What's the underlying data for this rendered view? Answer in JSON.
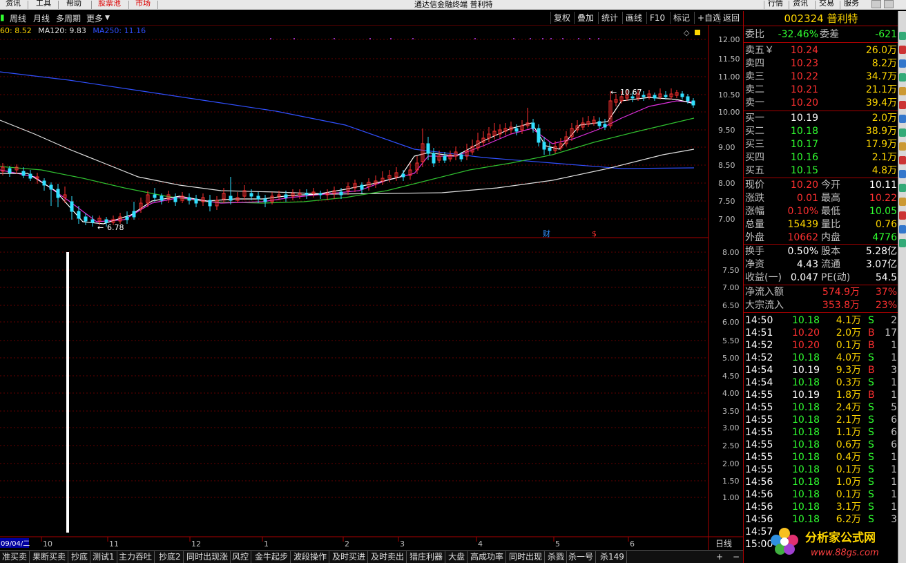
{
  "menubar": {
    "left_items": [
      "资讯",
      "工具",
      "帮助",
      "股票池",
      "市场"
    ],
    "window_title": "通达信金融终端 普利特",
    "right_items": [
      "行情",
      "资讯",
      "交易",
      "服务"
    ]
  },
  "period_bar": {
    "items": [
      "周线",
      "月线",
      "多周期",
      "更多"
    ],
    "right_buttons": [
      "复权",
      "叠加",
      "统计",
      "画线",
      "F10",
      "标记",
      "+自选",
      "返回"
    ]
  },
  "ma_legend": [
    {
      "text": "60: 8.52",
      "color": "#ffd700"
    },
    {
      "text": "MA120: 9.83",
      "color": "#e0e0e0"
    },
    {
      "text": "MA250: 11.16",
      "color": "#3050ff"
    }
  ],
  "price_axis": [
    "12.00",
    "11.50",
    "11.00",
    "10.50",
    "10.00",
    "9.50",
    "9.00",
    "8.50",
    "8.00",
    "7.50",
    "7.00"
  ],
  "lower_axis": [
    "8.00",
    "7.50",
    "7.00",
    "6.50",
    "6.00",
    "5.50",
    "5.00",
    "4.50",
    "4.00",
    "3.50",
    "3.00",
    "2.50",
    "2.00",
    "1.50",
    "1.00"
  ],
  "chart_annotations": {
    "high": "10.67",
    "low": "6.78",
    "fin_marker": "财",
    "s_marker": "$"
  },
  "x_axis": {
    "date_box": "09/04/二",
    "months": [
      "10",
      "11",
      "12",
      "1",
      "2",
      "3",
      "4",
      "5",
      "6"
    ],
    "period_label": "日线"
  },
  "bottom_tabs": [
    "准买卖",
    "果断买卖",
    "抄底",
    "测试1",
    "主力吞吐",
    "抄底2",
    "同时出现涨",
    "风控",
    "金牛起步",
    "波段操作",
    "及时买进",
    "及时卖出",
    "猎庄利器",
    "大盘",
    "高成功率",
    "同时出现",
    "杀戮",
    "杀一号",
    "杀149"
  ],
  "quote": {
    "code": "002324",
    "name": "普利特",
    "weibi": {
      "label": "委比",
      "value": "-32.46%",
      "label2": "委差",
      "value2": "-621"
    },
    "sell": [
      {
        "label": "卖五￥",
        "price": "10.24",
        "vol": "26.0万"
      },
      {
        "label": "卖四",
        "price": "10.23",
        "vol": "8.2万"
      },
      {
        "label": "卖三",
        "price": "10.22",
        "vol": "34.7万"
      },
      {
        "label": "卖二",
        "price": "10.21",
        "vol": "21.1万"
      },
      {
        "label": "卖一",
        "price": "10.20",
        "vol": "39.4万"
      }
    ],
    "buy": [
      {
        "label": "买一",
        "price": "10.19",
        "vol": "2.0万"
      },
      {
        "label": "买二",
        "price": "10.18",
        "vol": "38.9万"
      },
      {
        "label": "买三",
        "price": "10.17",
        "vol": "17.9万"
      },
      {
        "label": "买四",
        "price": "10.16",
        "vol": "2.1万"
      },
      {
        "label": "买五",
        "price": "10.15",
        "vol": "4.8万"
      }
    ],
    "stats": [
      {
        "l1": "现价",
        "v1": "10.20",
        "l2": "今开",
        "v2": "10.11"
      },
      {
        "l1": "涨跌",
        "v1": "0.01",
        "l2": "最高",
        "v2": "10.22"
      },
      {
        "l1": "涨幅",
        "v1": "0.10%",
        "l2": "最低",
        "v2": "10.05"
      },
      {
        "l1": "总量",
        "v1": "15439",
        "l2": "量比",
        "v2": "0.76"
      },
      {
        "l1": "外盘",
        "v1": "10662",
        "l2": "内盘",
        "v2": "4776"
      }
    ],
    "stats2": [
      {
        "l1": "换手",
        "v1": "0.50%",
        "l2": "股本",
        "v2": "5.28亿"
      },
      {
        "l1": "净资",
        "v1": "4.43",
        "l2": "流通",
        "v2": "3.07亿"
      },
      {
        "l1": "收益(一)",
        "v1": "0.047",
        "l2": "PE(动)",
        "v2": "54.5"
      }
    ],
    "flows": [
      {
        "label": "净流入额",
        "value": "574.9万",
        "pct": "37%"
      },
      {
        "label": "大宗流入",
        "value": "353.8万",
        "pct": "23%"
      }
    ],
    "ticks": [
      {
        "t": "14:50",
        "p": "10.18",
        "v": "4.1万",
        "d": "S",
        "n": "2"
      },
      {
        "t": "14:51",
        "p": "10.20",
        "v": "2.0万",
        "d": "B",
        "n": "17"
      },
      {
        "t": "14:52",
        "p": "10.20",
        "v": "0.1万",
        "d": "B",
        "n": "1"
      },
      {
        "t": "14:52",
        "p": "10.18",
        "v": "4.0万",
        "d": "S",
        "n": "1"
      },
      {
        "t": "14:54",
        "p": "10.19",
        "v": "9.3万",
        "d": "B",
        "n": "3"
      },
      {
        "t": "14:54",
        "p": "10.18",
        "v": "0.3万",
        "d": "S",
        "n": "1"
      },
      {
        "t": "14:55",
        "p": "10.19",
        "v": "1.8万",
        "d": "B",
        "n": "1"
      },
      {
        "t": "14:55",
        "p": "10.18",
        "v": "2.4万",
        "d": "S",
        "n": "5"
      },
      {
        "t": "14:55",
        "p": "10.18",
        "v": "2.1万",
        "d": "S",
        "n": "6"
      },
      {
        "t": "14:55",
        "p": "10.18",
        "v": "1.1万",
        "d": "S",
        "n": "6"
      },
      {
        "t": "14:55",
        "p": "10.18",
        "v": "0.6万",
        "d": "S",
        "n": "6"
      },
      {
        "t": "14:55",
        "p": "10.18",
        "v": "0.4万",
        "d": "S",
        "n": "1"
      },
      {
        "t": "14:55",
        "p": "10.18",
        "v": "0.1万",
        "d": "S",
        "n": "1"
      },
      {
        "t": "14:56",
        "p": "10.18",
        "v": "1.0万",
        "d": "S",
        "n": "1"
      },
      {
        "t": "14:56",
        "p": "10.18",
        "v": "0.1万",
        "d": "S",
        "n": "1"
      },
      {
        "t": "14:56",
        "p": "10.18",
        "v": "3.1万",
        "d": "S",
        "n": "1"
      },
      {
        "t": "14:56",
        "p": "10.18",
        "v": "6.2万",
        "d": "S",
        "n": "3"
      },
      {
        "t": "14:57",
        "p": "",
        "v": "",
        "d": "",
        "n": ""
      },
      {
        "t": "15:00",
        "p": "",
        "v": "",
        "d": "",
        "n": ""
      }
    ]
  },
  "logo": {
    "text": "分析家公式网",
    "url": "www.88gs.com"
  }
}
